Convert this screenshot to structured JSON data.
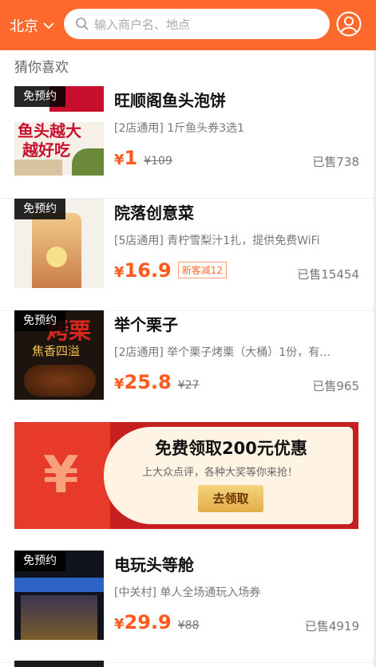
{
  "header": {
    "city": "北京",
    "search_placeholder": "输入商户名、地点"
  },
  "section_title": "猜你喜欢",
  "items": [
    {
      "tag": "免预约",
      "name": "旺顺阁鱼头泡饼",
      "desc": "[2店通用] 1斤鱼头券3选1",
      "price_symbol": "¥",
      "price": "1",
      "original_price": "¥109",
      "sold": "已售738",
      "thumb_text1": "鱼头越大",
      "thumb_text2": "越好吃"
    },
    {
      "tag": "免预约",
      "name": "院落创意菜",
      "desc": "[5店通用] 青柠雪梨汁1扎，提供免费WiFi",
      "price_symbol": "¥",
      "price": "16.9",
      "coupon": "新客减12",
      "sold": "已售15454"
    },
    {
      "tag": "免预约",
      "name": "举个栗子",
      "desc": "[2店通用] 举个栗子烤栗（大桶）1份，有…",
      "price_symbol": "¥",
      "price": "25.8",
      "original_price": "¥27",
      "sold": "已售965",
      "thumb_text1": "烤栗",
      "thumb_text2": "焦香四溢"
    },
    {
      "tag": "免预约",
      "name": "电玩头等舱",
      "desc": "[中关村] 单人全场通玩入场券",
      "price_symbol": "¥",
      "price": "29.9",
      "original_price": "¥88",
      "sold": "已售4919"
    }
  ],
  "banner": {
    "yen": "¥",
    "title": "免费领取200元优惠",
    "subtitle": "上大众点评，各种大奖等你来抢！",
    "button": "去领取"
  },
  "colors": {
    "brand": "#ff6a2c",
    "price": "#ff5a1e",
    "banner_red": "#c61f1f"
  }
}
